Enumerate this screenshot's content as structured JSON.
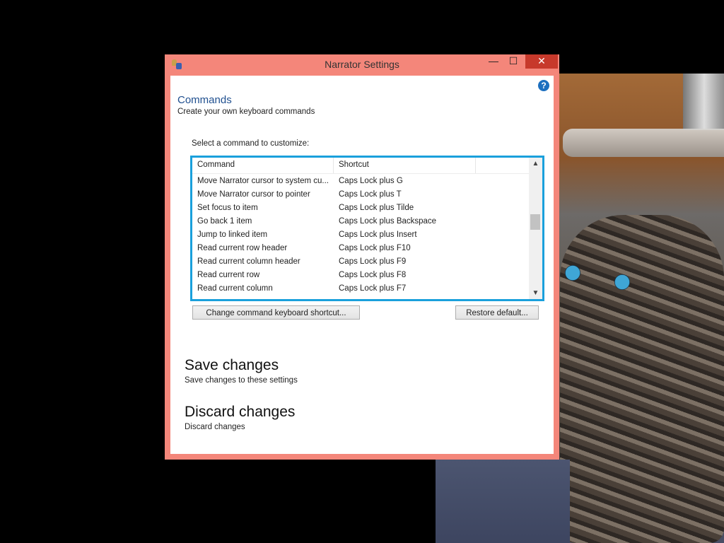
{
  "window": {
    "title": "Narrator Settings",
    "controls": {
      "minimize": "—",
      "maximize": "☐",
      "close": "✕"
    }
  },
  "help_icon": "?",
  "page": {
    "heading": "Commands",
    "subheading": "Create your own keyboard commands",
    "select_label": "Select a command to customize:"
  },
  "list": {
    "columns": [
      "Command",
      "Shortcut"
    ],
    "rows": [
      {
        "command": "Move Narrator cursor to system cu...",
        "shortcut": "Caps Lock plus G"
      },
      {
        "command": "Move Narrator cursor to pointer",
        "shortcut": "Caps Lock plus T"
      },
      {
        "command": "Set focus to item",
        "shortcut": "Caps Lock plus Tilde"
      },
      {
        "command": "Go back 1 item",
        "shortcut": "Caps Lock plus Backspace"
      },
      {
        "command": "Jump to linked item",
        "shortcut": "Caps Lock plus Insert"
      },
      {
        "command": "Read current row header",
        "shortcut": "Caps Lock plus F10"
      },
      {
        "command": "Read current column header",
        "shortcut": "Caps Lock plus F9"
      },
      {
        "command": "Read current row",
        "shortcut": "Caps Lock plus F8"
      },
      {
        "command": "Read current column",
        "shortcut": "Caps Lock plus F7"
      }
    ],
    "scroll_up": "▲",
    "scroll_down": "▼"
  },
  "buttons": {
    "change": "Change command keyboard shortcut...",
    "restore": "Restore default..."
  },
  "save": {
    "label": "Save changes",
    "description": "Save changes to these settings"
  },
  "discard": {
    "label": "Discard changes",
    "description": "Discard changes"
  },
  "colors": {
    "window_frame": "#f4867a",
    "close_button": "#c7392b",
    "list_focus_border": "#1aa0dc",
    "heading": "#1f4f8f"
  }
}
